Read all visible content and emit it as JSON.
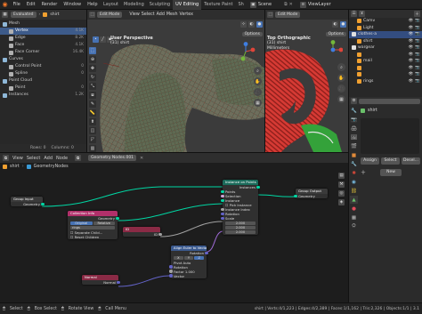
{
  "topbar": {
    "menus": [
      "File",
      "Edit",
      "Render",
      "Window",
      "Help"
    ],
    "workspaces": [
      "Layout",
      "Modeling",
      "Sculpting",
      "UV Editing",
      "Texture Paint",
      "Sh"
    ],
    "active_workspace": "UV Editing",
    "scene_label": "Scene",
    "view_layer_label": "ViewLayer"
  },
  "spreadsheet": {
    "mode": "Evaluated",
    "object": "shirt",
    "items": [
      {
        "label": "Mesh",
        "indent": 0,
        "count": ""
      },
      {
        "label": "Vertex",
        "indent": 1,
        "count": "4.1K",
        "selected": true
      },
      {
        "label": "Edge",
        "indent": 1,
        "count": "8.2K"
      },
      {
        "label": "Face",
        "indent": 1,
        "count": "4.1K"
      },
      {
        "label": "Face Corner",
        "indent": 1,
        "count": "16.4K"
      },
      {
        "label": "Curves",
        "indent": 0,
        "count": ""
      },
      {
        "label": "Control Point",
        "indent": 1,
        "count": "0"
      },
      {
        "label": "Spline",
        "indent": 1,
        "count": "0"
      },
      {
        "label": "Point Cloud",
        "indent": 0,
        "count": ""
      },
      {
        "label": "Point",
        "indent": 1,
        "count": "0"
      },
      {
        "label": "Instances",
        "indent": 0,
        "count": "1.2K"
      }
    ],
    "rows_label": "Rows: 0",
    "columns_label": "Columns: 0"
  },
  "viewport_left": {
    "mode": "Edit Mode",
    "menus": [
      "View",
      "Select",
      "Add",
      "Mesh",
      "Vertex"
    ],
    "title": "User Perspective",
    "subtitle": "(31) shirt",
    "options_label": "Options"
  },
  "viewport_right": {
    "mode": "Edit Mode",
    "title": "Top Orthographic",
    "subtitle": "(31) shirt",
    "unit": "Millimeters",
    "options_label": "Options"
  },
  "outliner": {
    "rows": [
      {
        "label": "Camv",
        "indent": 1
      },
      {
        "label": "Light",
        "indent": 1
      },
      {
        "label": "clothes-a",
        "indent": 0,
        "selected": true
      },
      {
        "label": "shirt",
        "indent": 1
      },
      {
        "label": "wargear",
        "indent": 0
      },
      {
        "label": "",
        "indent": 1
      },
      {
        "label": "mail",
        "indent": 1
      },
      {
        "label": "",
        "indent": 1
      },
      {
        "label": "",
        "indent": 1
      },
      {
        "label": "rings",
        "indent": 1
      }
    ]
  },
  "properties": {
    "object_name": "shirt",
    "buttons": [
      "Assign",
      "Select",
      "Desel..."
    ],
    "new_label": "New"
  },
  "node_editor": {
    "menus": [
      "View",
      "Select",
      "Add",
      "Node"
    ],
    "tree_label": "GeometryNodes",
    "tree_name": "Geometry Nodes.001",
    "breadcrumb": [
      "shirt",
      "GeometryNodes"
    ],
    "nodes": {
      "group_input": {
        "title": "Group Input",
        "outputs": [
          "Geometry"
        ]
      },
      "collection_info": {
        "title": "Collection Info",
        "outputs": [
          "Geometry"
        ],
        "toggle": [
          "Original",
          "Relative"
        ],
        "inputs": [
          "rings",
          "Separate Child...",
          "Reset Children"
        ]
      },
      "instance_on_points": {
        "title": "Instance on Points",
        "outputs": [
          "Instances"
        ],
        "inputs": [
          "Points",
          "Selection",
          "Instance",
          "Pick Instance",
          "Instance Index",
          "Rotation",
          "Scale"
        ],
        "scale": [
          "2.000",
          "2.000",
          "2.000"
        ]
      },
      "group_output": {
        "title": "Group Output",
        "inputs": [
          "Geometry"
        ]
      },
      "id_node": {
        "title": "ID",
        "outputs": [
          "ID"
        ]
      },
      "align_euler": {
        "title": "Align Euler to Vector",
        "outputs": [
          "Rotation"
        ],
        "inputs": [
          "Rotation",
          "Factor",
          "Vector"
        ],
        "axes": [
          "X",
          "Y",
          "Z"
        ],
        "pivot": [
          "Pivot",
          "Auto"
        ],
        "factor": "1.000"
      },
      "normal": {
        "title": "Normal",
        "outputs": [
          "Normal"
        ]
      }
    }
  },
  "status": {
    "items": [
      "Select",
      "Box Select",
      "Rotate View",
      "Call Menu"
    ],
    "stats": "shirt | Verts:4/1,223 | Edges:4/2,389 | Faces:1/1,162 | Tris:2,326 | Objects:1/1 | 3.1"
  },
  "colors": {
    "accent": "#4772b3",
    "geometry_socket": "#00d6a3",
    "node_geometry_header": "#1b6b5b",
    "node_input_header": "#8a2a45",
    "node_vector_header": "#3b5a8f"
  }
}
